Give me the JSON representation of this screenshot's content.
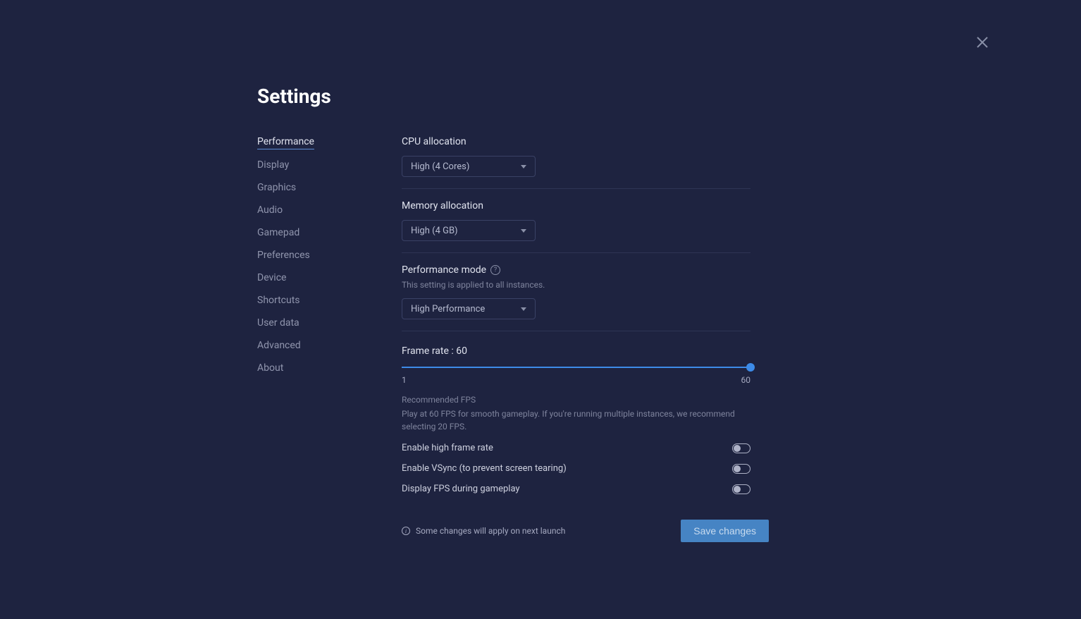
{
  "title": "Settings",
  "sidebar": {
    "items": [
      {
        "label": "Performance",
        "active": true
      },
      {
        "label": "Display",
        "active": false
      },
      {
        "label": "Graphics",
        "active": false
      },
      {
        "label": "Audio",
        "active": false
      },
      {
        "label": "Gamepad",
        "active": false
      },
      {
        "label": "Preferences",
        "active": false
      },
      {
        "label": "Device",
        "active": false
      },
      {
        "label": "Shortcuts",
        "active": false
      },
      {
        "label": "User data",
        "active": false
      },
      {
        "label": "Advanced",
        "active": false
      },
      {
        "label": "About",
        "active": false
      }
    ]
  },
  "main": {
    "cpu": {
      "label": "CPU allocation",
      "value": "High (4 Cores)"
    },
    "memory": {
      "label": "Memory allocation",
      "value": "High (4 GB)"
    },
    "perfmode": {
      "label": "Performance mode",
      "subtext": "This setting is applied to all instances.",
      "value": "High Performance"
    },
    "framerate": {
      "label": "Frame rate : 60",
      "min": "1",
      "max": "60",
      "rec_title": "Recommended FPS",
      "rec_text": "Play at 60 FPS for smooth gameplay. If you're running multiple instances, we recommend selecting 20 FPS."
    },
    "toggles": {
      "highframe": "Enable high frame rate",
      "vsync": "Enable VSync (to prevent screen tearing)",
      "displayfps": "Display FPS during gameplay"
    }
  },
  "footer": {
    "info": "Some changes will apply on next launch",
    "save": "Save changes"
  }
}
